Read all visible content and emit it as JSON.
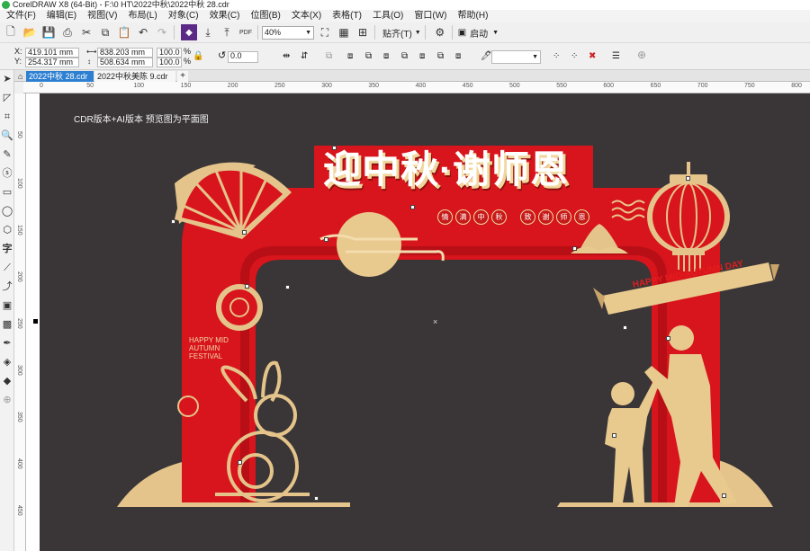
{
  "window": {
    "title": "CorelDRAW X8 (64-Bit) - F:\\0 HT\\2022中秋\\2022中秋 28.cdr"
  },
  "menu": [
    "文件(F)",
    "编辑(E)",
    "视图(V)",
    "布局(L)",
    "对象(C)",
    "效果(C)",
    "位图(B)",
    "文本(X)",
    "表格(T)",
    "工具(O)",
    "窗口(W)",
    "帮助(H)"
  ],
  "toolbar": {
    "zoom": "40%",
    "snap_label": "贴齐(T)",
    "launch_label": "启动"
  },
  "property_bar": {
    "x": "419.101 mm",
    "y": "254.317 mm",
    "width": "838.203 mm",
    "height": "508.634 mm",
    "scale_x": "100.0",
    "scale_y": "100.0",
    "percent": "%",
    "rotation": "0.0",
    "x_label": "X:",
    "y_label": "Y:"
  },
  "tabs": [
    {
      "label": "2022中秋 28.cdr",
      "active": true
    },
    {
      "label": "2022中秋美陈 9.cdr",
      "active": false
    }
  ],
  "ruler": {
    "h_ticks": [
      "0",
      "50",
      "100",
      "150",
      "200",
      "250",
      "300",
      "350",
      "400",
      "450",
      "500",
      "550",
      "600",
      "650",
      "700",
      "750",
      "800"
    ],
    "v_ticks": [
      "50",
      "100",
      "150",
      "200",
      "250",
      "300",
      "350",
      "400",
      "450",
      "500"
    ]
  },
  "artwork": {
    "caption": "CDR版本+AI版本  预览图为平面图",
    "title": "迎中秋·谢师恩",
    "subtitle_chars": [
      "情",
      "满",
      "中",
      "秋",
      "致",
      "谢",
      "师",
      "恩"
    ],
    "ribbon_text": "HAPPY MID-AUTUMN DAY",
    "side_text": "HAPPY MID\nAUTUMN\nFESTIVAL",
    "colors": {
      "red": "#d8141c",
      "gold": "#e8c98e",
      "background": "#3a3536"
    }
  }
}
